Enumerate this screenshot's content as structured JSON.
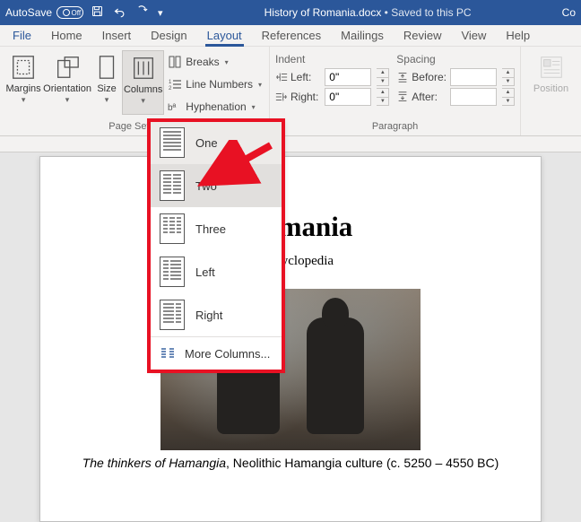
{
  "titlebar": {
    "autosave_label": "AutoSave",
    "autosave_state": "Off",
    "doc_name": "History of Romania.docx",
    "save_state": "Saved to this PC",
    "right_hint": "Co"
  },
  "tabs": {
    "file": "File",
    "home": "Home",
    "insert": "Insert",
    "design": "Design",
    "layout": "Layout",
    "references": "References",
    "mailings": "Mailings",
    "review": "Review",
    "view": "View",
    "help": "Help"
  },
  "ribbon": {
    "page_setup": {
      "margins": "Margins",
      "orientation": "Orientation",
      "size": "Size",
      "columns": "Columns",
      "breaks": "Breaks",
      "line_numbers": "Line Numbers",
      "hyphenation": "Hyphenation",
      "group_label": "Page Setup"
    },
    "paragraph": {
      "indent_header": "Indent",
      "spacing_header": "Spacing",
      "left_label": "Left:",
      "right_label": "Right:",
      "before_label": "Before:",
      "after_label": "After:",
      "left_value": "0\"",
      "right_value": "0\"",
      "before_value": "",
      "after_value": "",
      "group_label": "Paragraph"
    },
    "arrange": {
      "position": "Position"
    }
  },
  "columns_menu": {
    "one": "One",
    "two": "Two",
    "three": "Three",
    "left": "Left",
    "right": "Right",
    "more": "More Columns..."
  },
  "document": {
    "title": "f Romania",
    "subtitle": "ee encyclopedia",
    "caption_italic": "The thinkers of Hamangia",
    "caption_rest": ", Neolithic Hamangia culture (c. 5250 – 4550 BC)"
  }
}
